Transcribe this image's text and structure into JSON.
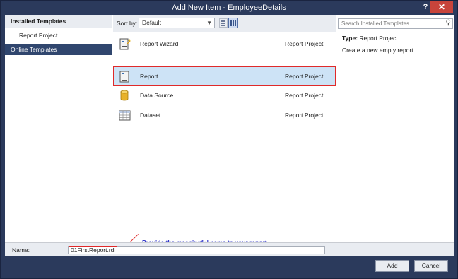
{
  "window": {
    "title": "Add New Item - EmployeeDetails",
    "help": "?",
    "close": "✕"
  },
  "left_pane": {
    "header": "Installed Templates",
    "items": [
      {
        "label": "Report Project"
      }
    ],
    "online": "Online Templates"
  },
  "toolbar": {
    "sort_label": "Sort by:",
    "sort_value": "Default"
  },
  "templates": [
    {
      "name": "Report Wizard",
      "category": "Report Project",
      "icon": "report-wizard-icon"
    },
    {
      "name": "Report",
      "category": "Report Project",
      "icon": "report-icon",
      "selected": true
    },
    {
      "name": "Data Source",
      "category": "Report Project",
      "icon": "data-source-icon"
    },
    {
      "name": "Dataset",
      "category": "Report Project",
      "icon": "dataset-icon"
    }
  ],
  "details": {
    "search_placeholder": "Search Installed Templates",
    "type_label": "Type:",
    "type_value": "Report Project",
    "description": "Create a new empty report."
  },
  "annotation": "Provide the meaningful name to your report",
  "name_field": {
    "label": "Name:",
    "value": "01FirstReport.rdl"
  },
  "buttons": {
    "add": "Add",
    "cancel": "Cancel"
  },
  "colors": {
    "chrome": "#2b3a5c",
    "selection": "#cde3f6",
    "highlight_border": "#e02a2a",
    "annotation_text": "#3338c9"
  }
}
